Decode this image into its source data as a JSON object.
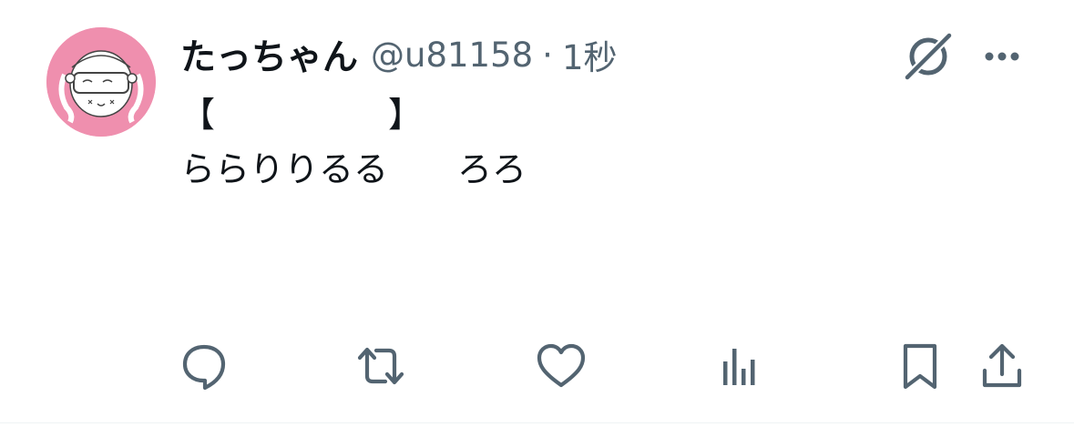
{
  "tweet": {
    "display_name": "たっちゃん",
    "handle": "@u81158",
    "separator": "·",
    "timestamp": "1秒",
    "body_lines": [
      "【　　　　　】",
      "ららりりるる　　ろろ"
    ]
  },
  "icons": {
    "grok": "grok-icon",
    "more": "more-icon",
    "reply": "reply-icon",
    "retweet": "retweet-icon",
    "like": "like-icon",
    "views": "views-icon",
    "bookmark": "bookmark-icon",
    "share": "share-icon"
  },
  "colors": {
    "text_primary": "#0f1419",
    "text_secondary": "#536471",
    "avatar_bg": "#ef8fae",
    "divider": "#eff3f4"
  }
}
